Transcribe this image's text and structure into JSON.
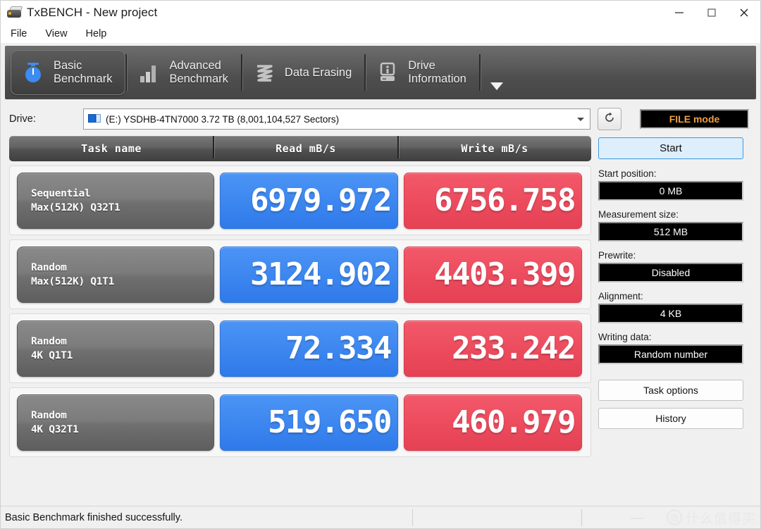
{
  "window": {
    "title": "TxBENCH - New project",
    "app_icon": "disk-drive-icon",
    "minimize_label": "Minimize",
    "maximize_label": "Maximize",
    "close_label": "Close"
  },
  "menu": {
    "items": [
      {
        "label": "File"
      },
      {
        "label": "View"
      },
      {
        "label": "Help"
      }
    ]
  },
  "tabs": {
    "items": [
      {
        "label": "Basic\nBenchmark",
        "icon": "stopwatch-icon",
        "active": true
      },
      {
        "label": "Advanced\nBenchmark",
        "icon": "bar-chart-icon",
        "active": false
      },
      {
        "label": "Data Erasing",
        "icon": "shred-icon",
        "active": false
      },
      {
        "label": "Drive\nInformation",
        "icon": "drive-info-icon",
        "active": false
      }
    ],
    "overflow_icon": "chevron-down-icon"
  },
  "drive": {
    "label": "Drive:",
    "selected": "(E:) YSDHB-4TN7000  3.72 TB (8,001,104,527 Sectors)",
    "icon": "network-drive-icon",
    "refresh_icon": "refresh-icon",
    "file_mode_label": "FILE mode",
    "file_mode_color": "#f0a040"
  },
  "results": {
    "columns": [
      "Task name",
      "Read mB/s",
      "Write mB/s"
    ],
    "rows": [
      {
        "name_line1": "Sequential",
        "name_line2": "Max(512K) Q32T1",
        "read": "6979.972",
        "write": "6756.758"
      },
      {
        "name_line1": "Random",
        "name_line2": "Max(512K) Q1T1",
        "read": "3124.902",
        "write": "4403.399"
      },
      {
        "name_line1": "Random",
        "name_line2": "4K Q1T1",
        "read": "72.334",
        "write": "233.242"
      },
      {
        "name_line1": "Random",
        "name_line2": "4K Q32T1",
        "read": "519.650",
        "write": "460.979"
      }
    ],
    "read_color": "#3d87f0",
    "write_color": "#ec4c5e"
  },
  "panel": {
    "start_label": "Start",
    "fields": [
      {
        "label": "Start position:",
        "value": "0 MB"
      },
      {
        "label": "Measurement size:",
        "value": "512 MB"
      },
      {
        "label": "Prewrite:",
        "value": "Disabled"
      },
      {
        "label": "Alignment:",
        "value": "4 KB"
      },
      {
        "label": "Writing data:",
        "value": "Random number"
      }
    ],
    "task_options_label": "Task options",
    "history_label": "History"
  },
  "status": {
    "message": "Basic Benchmark finished successfully.",
    "watermark_badge": "值",
    "watermark_text": "什么值得买"
  }
}
